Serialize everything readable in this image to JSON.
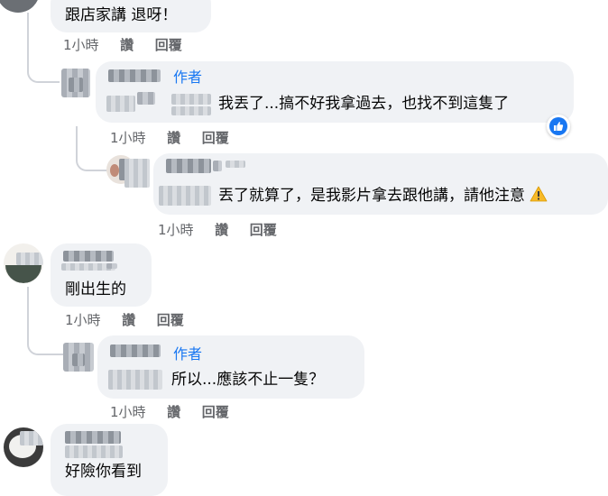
{
  "comments": [
    {
      "text": "跟店家講 退呀！",
      "actions": {
        "time": "1小時",
        "like": "讚",
        "reply": "回覆"
      }
    },
    {
      "author_badge": "作者",
      "text": "我丟了...搞不好我拿過去，也找不到這隻了",
      "reaction_icon": "like-thumb-icon",
      "actions": {
        "time": "1小時",
        "like": "讚",
        "reply": "回覆"
      }
    },
    {
      "text": "丟了就算了，是我影片拿去跟他講，請他注意",
      "trailing_icon": "warning-icon",
      "actions": {
        "time": "1小時",
        "like": "讚",
        "reply": "回覆"
      }
    },
    {
      "text": "剛出生的",
      "actions": {
        "time": "1小時",
        "like": "讚",
        "reply": "回覆"
      }
    },
    {
      "author_badge": "作者",
      "text": "所以...應該不止一隻？",
      "actions": {
        "time": "1小時",
        "like": "讚",
        "reply": "回覆"
      }
    },
    {
      "text": "好險你看到"
    }
  ],
  "colors": {
    "bubble": "#f0f2f5",
    "author_badge": "#1877f2",
    "meta_text": "#65676b",
    "like_badge": "#1877f2",
    "warning": "#f7b928"
  }
}
